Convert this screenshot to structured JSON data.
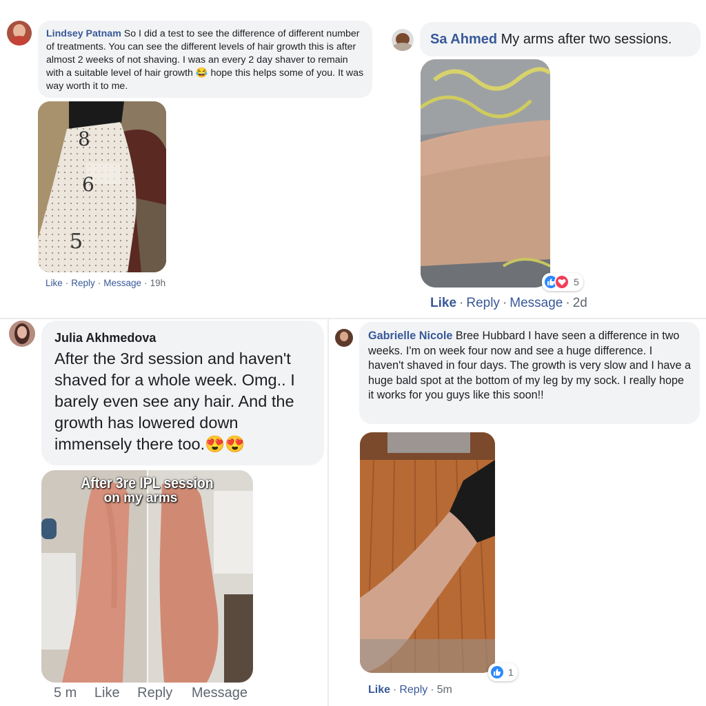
{
  "comments": [
    {
      "author": "Lindsey Patnam",
      "text": "So I did a test to see the difference of different number of treatments. You can see the different levels of hair growth this is after almost 2 weeks of not shaving. I was an every 2 day shaver to remain with a suitable level of hair growth",
      "text_end": "hope this helps some of you. It was way worth it to me.",
      "emoji": "😂",
      "photo_marks": [
        "8",
        "6",
        "5"
      ],
      "actions": {
        "like": "Like",
        "reply": "Reply",
        "message": "Message",
        "time": "19h"
      }
    },
    {
      "author": "Sa Ahmed",
      "text": "My arms after two sessions.",
      "reaction_count": "5",
      "actions": {
        "like": "Like",
        "reply": "Reply",
        "message": "Message",
        "time": "2d"
      }
    },
    {
      "author": "Julia Akhmedova",
      "text": "After the 3rd session and haven't shaved for a whole week.  Omg.. I barely even see any hair.  And the growth has lowered down immensely there too.",
      "emoji": "😍😍",
      "photo_caption_1": "After 3re IPL session",
      "photo_caption_2": "on my arms",
      "actions": {
        "time": "5 m",
        "like": "Like",
        "reply": "Reply",
        "message": "Message"
      }
    },
    {
      "author": "Gabrielle Nicole",
      "text": "Bree Hubbard I have seen a difference in two weeks. I'm on week four now and see a huge difference. I haven't shaved in four days. The growth is very slow and I have a huge bald spot at the bottom of my leg by my sock. I really hope it works for you guys like this soon!!",
      "reaction_count": "1",
      "actions": {
        "like": "Like",
        "reply": "Reply",
        "time": "5m"
      }
    }
  ],
  "action_separator": "·",
  "icons": {
    "avatar": "avatar",
    "like_reaction": "thumbs-up-icon",
    "love_reaction": "heart-icon"
  },
  "colors": {
    "link": "#385898",
    "bubble": "#f2f3f5",
    "like_blue": "#2d88ff",
    "love_red": "#f33e58",
    "meta_grey": "#606770"
  }
}
